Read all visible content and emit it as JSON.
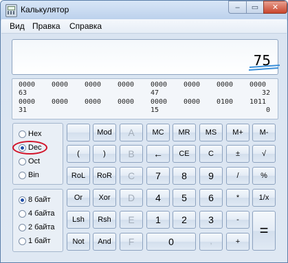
{
  "window": {
    "title": "Калькулятор",
    "close_glyph": "✕",
    "min_glyph": "–",
    "max_glyph": "▭"
  },
  "menu": [
    "Вид",
    "Правка",
    "Справка"
  ],
  "display": {
    "value": "75"
  },
  "bits": {
    "row1": [
      "0000",
      "0000",
      "0000",
      "0000",
      "0000",
      "0000",
      "0000",
      "0000"
    ],
    "row1_labels": [
      "63",
      "47",
      "32"
    ],
    "row2": [
      "0000",
      "0000",
      "0000",
      "0000",
      "0000",
      "0000",
      "0100",
      "1011"
    ],
    "row2_labels": [
      "31",
      "15",
      "0"
    ]
  },
  "base_options": [
    {
      "label": "Hex",
      "selected": false
    },
    {
      "label": "Dec",
      "selected": true
    },
    {
      "label": "Oct",
      "selected": false
    },
    {
      "label": "Bin",
      "selected": false
    }
  ],
  "word_options": [
    {
      "label": "8 байт",
      "selected": true
    },
    {
      "label": "4 байта",
      "selected": false
    },
    {
      "label": "2 байта",
      "selected": false
    },
    {
      "label": "1 байт",
      "selected": false
    }
  ],
  "keys": [
    [
      "",
      "Mod",
      "A",
      "MC",
      "MR",
      "MS",
      "M+",
      "M-"
    ],
    [
      "(",
      ")",
      "B",
      "←",
      "CE",
      "C",
      "±",
      "√"
    ],
    [
      "RoL",
      "RoR",
      "C",
      "7",
      "8",
      "9",
      "/",
      "%"
    ],
    [
      "Or",
      "Xor",
      "D",
      "4",
      "5",
      "6",
      "*",
      "1/x"
    ],
    [
      "Lsh",
      "Rsh",
      "E",
      "1",
      "2",
      "3",
      "-",
      "="
    ],
    [
      "Not",
      "And",
      "F",
      "0",
      ",",
      "+"
    ]
  ],
  "colors": {
    "accent": "#1f4fa8",
    "annotation": "#d2142a",
    "underline": "#3b8fd9"
  }
}
